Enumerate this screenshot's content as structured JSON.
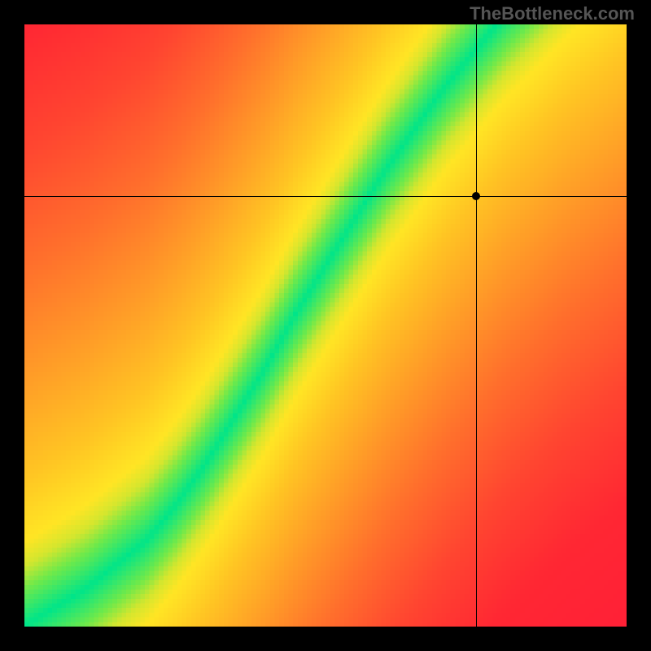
{
  "watermark": "TheBottleneck.com",
  "chart_data": {
    "type": "heatmap",
    "title": "",
    "xlabel": "",
    "ylabel": "",
    "xlim": [
      0,
      1
    ],
    "ylim": [
      0,
      1
    ],
    "marker": {
      "x": 0.75,
      "y": 0.715
    },
    "ideal_curve": [
      {
        "x": 0.0,
        "y": 0.0
      },
      {
        "x": 0.05,
        "y": 0.03
      },
      {
        "x": 0.1,
        "y": 0.06
      },
      {
        "x": 0.15,
        "y": 0.1
      },
      {
        "x": 0.2,
        "y": 0.14
      },
      {
        "x": 0.25,
        "y": 0.2
      },
      {
        "x": 0.3,
        "y": 0.27
      },
      {
        "x": 0.35,
        "y": 0.35
      },
      {
        "x": 0.4,
        "y": 0.43
      },
      {
        "x": 0.45,
        "y": 0.52
      },
      {
        "x": 0.5,
        "y": 0.6
      },
      {
        "x": 0.55,
        "y": 0.68
      },
      {
        "x": 0.6,
        "y": 0.76
      },
      {
        "x": 0.65,
        "y": 0.83
      },
      {
        "x": 0.7,
        "y": 0.9
      },
      {
        "x": 0.75,
        "y": 0.96
      },
      {
        "x": 0.8,
        "y": 1.02
      },
      {
        "x": 0.85,
        "y": 1.07
      },
      {
        "x": 0.9,
        "y": 1.12
      },
      {
        "x": 0.95,
        "y": 1.16
      },
      {
        "x": 1.0,
        "y": 1.2
      }
    ],
    "color_scale": [
      {
        "d": 0.0,
        "color": "#00E589"
      },
      {
        "d": 0.06,
        "color": "#6FE94A"
      },
      {
        "d": 0.1,
        "color": "#D4E62E"
      },
      {
        "d": 0.14,
        "color": "#FFE524"
      },
      {
        "d": 0.25,
        "color": "#FFC423"
      },
      {
        "d": 0.4,
        "color": "#FF9F27"
      },
      {
        "d": 0.6,
        "color": "#FF6F2C"
      },
      {
        "d": 0.8,
        "color": "#FF4530"
      },
      {
        "d": 1.0,
        "color": "#FF2733"
      },
      {
        "d": 1.4,
        "color": "#FF1A3A"
      }
    ],
    "grid_size": 130
  }
}
